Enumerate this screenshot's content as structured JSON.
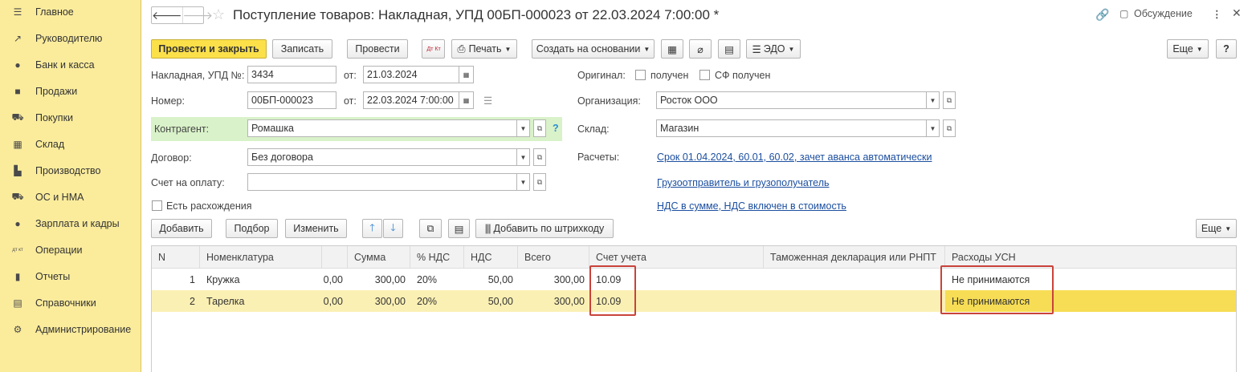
{
  "sidebar": {
    "items": [
      {
        "label": "Главное",
        "icon": "menu-icon",
        "glyph": "☰"
      },
      {
        "label": "Руководителю",
        "icon": "trend-icon",
        "glyph": "↗"
      },
      {
        "label": "Банк и касса",
        "icon": "coin-icon",
        "glyph": "●"
      },
      {
        "label": "Продажи",
        "icon": "bag-icon",
        "glyph": "■"
      },
      {
        "label": "Покупки",
        "icon": "cart-icon",
        "glyph": "⛟"
      },
      {
        "label": "Склад",
        "icon": "warehouse-icon",
        "glyph": "▦"
      },
      {
        "label": "Производство",
        "icon": "factory-icon",
        "glyph": "▙"
      },
      {
        "label": "ОС и НМА",
        "icon": "truck-icon",
        "glyph": "⛟"
      },
      {
        "label": "Зарплата и кадры",
        "icon": "person-icon",
        "glyph": "●"
      },
      {
        "label": "Операции",
        "icon": "dt-kt-icon",
        "glyph": "дт кт"
      },
      {
        "label": "Отчеты",
        "icon": "bar-chart-icon",
        "glyph": "▮"
      },
      {
        "label": "Справочники",
        "icon": "book-icon",
        "glyph": "▤"
      },
      {
        "label": "Администрирование",
        "icon": "gear-icon",
        "glyph": "⚙"
      }
    ]
  },
  "header": {
    "title": "Поступление товаров: Накладная, УПД 00БП-000023 от 22.03.2024 7:00:00 *",
    "discussion": "Обсуждение",
    "back_glyph": "🡐",
    "forward_glyph": "🡒"
  },
  "toolbar": {
    "post_close": "Провести и закрыть",
    "save": "Записать",
    "post": "Провести",
    "dt_kt": "Дт Кт",
    "print": "Печать",
    "create_based": "Создать на основании",
    "edo": "ЭДО",
    "more": "Еще",
    "help": "?"
  },
  "form": {
    "invoice_label": "Накладная, УПД №:",
    "invoice_value": "3434",
    "from_label": "от:",
    "invoice_date": "21.03.2024",
    "number_label": "Номер:",
    "number_value": "00БП-000023",
    "number_date": "22.03.2024  7:00:00",
    "original_label": "Оригинал:",
    "received_label": "получен",
    "sf_received_label": "СФ получен",
    "org_label": "Организация:",
    "org_value": "Росток ООО",
    "counterparty_label": "Контрагент:",
    "counterparty_value": "Ромашка",
    "warehouse_label": "Склад:",
    "warehouse_value": "Магазин",
    "contract_label": "Договор:",
    "contract_value": "Без договора",
    "settlements_label": "Расчеты:",
    "settlements_link": "Срок 01.04.2024, 60.01, 60.02, зачет аванса автоматически",
    "invoice_pay_label": "Счет на оплату:",
    "invoice_pay_value": "",
    "shipper_link": "Грузоотправитель и грузополучатель",
    "vat_link": "НДС в сумме, НДС включен в стоимость",
    "discrepancy_label": "Есть расхождения"
  },
  "table_toolbar": {
    "add": "Добавить",
    "pick": "Подбор",
    "edit": "Изменить",
    "add_barcode": "Добавить по штрихкоду",
    "more": "Еще"
  },
  "table": {
    "columns": [
      "N",
      "Номенклатура",
      "",
      "Сумма",
      "% НДС",
      "НДС",
      "Всего",
      "Счет учета",
      "Таможенная декларация или РНПТ",
      "Расходы УСН"
    ],
    "rows": [
      {
        "n": "1",
        "name": "Кружка",
        "price": "0,00",
        "sum": "300,00",
        "vat_rate": "20%",
        "vat": "50,00",
        "total": "300,00",
        "account": "10.09",
        "customs": "",
        "usn": "Не принимаются"
      },
      {
        "n": "2",
        "name": "Тарелка",
        "price": "0,00",
        "sum": "300,00",
        "vat_rate": "20%",
        "vat": "50,00",
        "total": "300,00",
        "account": "10.09",
        "customs": "",
        "usn": "Не принимаются"
      }
    ]
  },
  "colors": {
    "sidebar_bg": "#fbec9c",
    "primary_button": "#fbe04a",
    "selected_row": "#fbf0b4",
    "highlight_box": "#c9433a",
    "link": "#1c4fa0"
  }
}
